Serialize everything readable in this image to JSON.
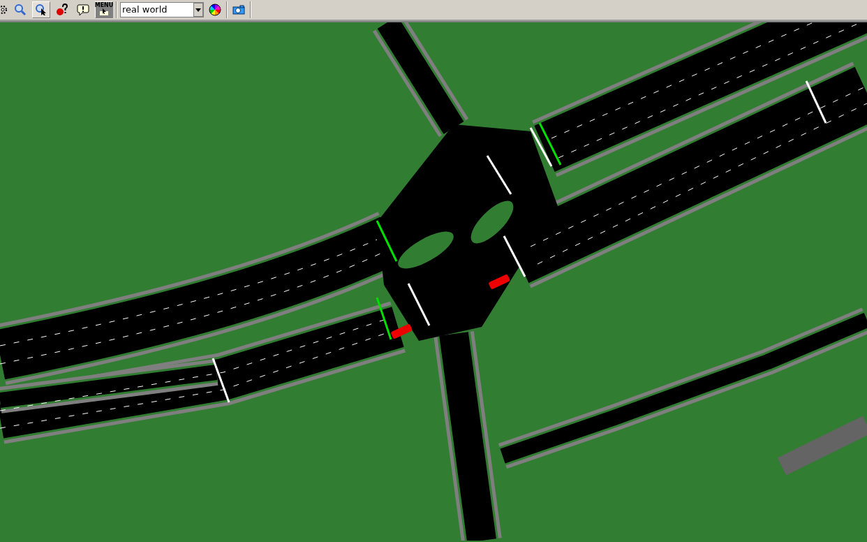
{
  "toolbar": {
    "buttons": [
      {
        "kind": "settings",
        "pressed": false
      },
      {
        "kind": "zoom",
        "pressed": false
      },
      {
        "kind": "locate",
        "pressed": true
      },
      {
        "kind": "help",
        "pressed": false
      },
      {
        "kind": "message",
        "pressed": false
      },
      {
        "kind": "menu",
        "pressed": true,
        "label": "MENU"
      }
    ],
    "scheme_select": {
      "value": "real world"
    },
    "tools": [
      {
        "kind": "color"
      },
      {
        "kind": "camera"
      }
    ]
  }
}
